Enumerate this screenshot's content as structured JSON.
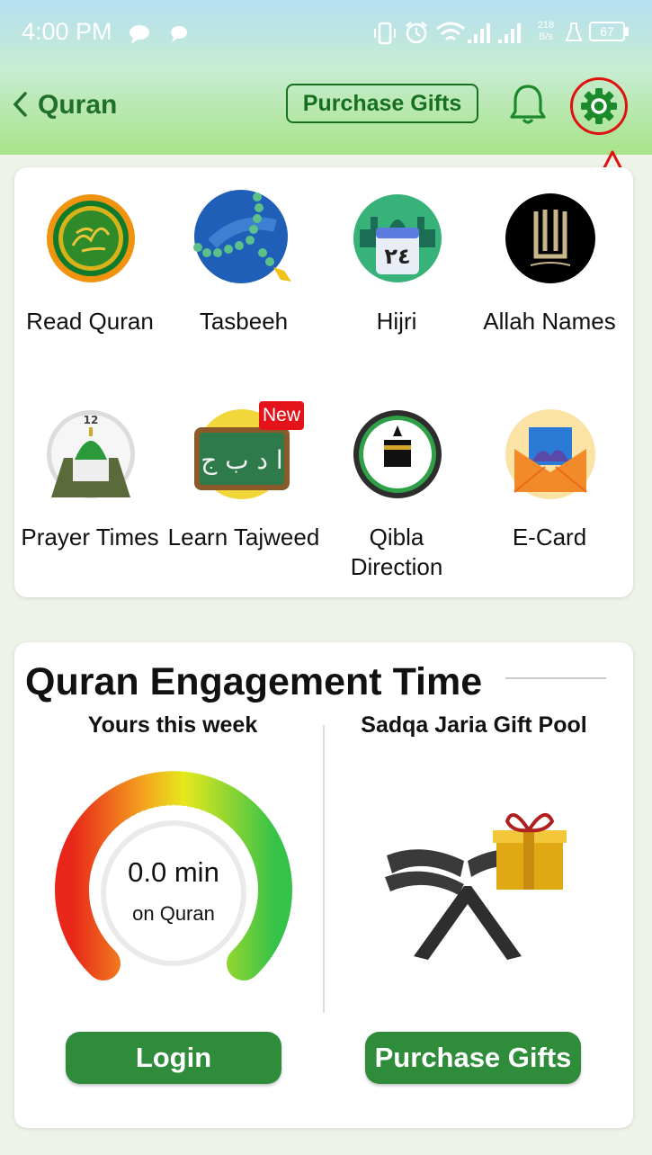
{
  "status_bar": {
    "time": "4:00 PM",
    "net_speed_value": "218",
    "net_speed_unit": "B/s",
    "battery": "67"
  },
  "header": {
    "title": "Quran",
    "purchase_label": "Purchase Gifts"
  },
  "features": [
    {
      "label": "Read Quran",
      "icon": "quran-emblem-icon"
    },
    {
      "label": "Tasbeeh",
      "icon": "prayer-beads-icon"
    },
    {
      "label": "Hijri",
      "icon": "hijri-calendar-icon",
      "calendar_text": "٢٤"
    },
    {
      "label": "Allah Names",
      "icon": "allah-calligraphy-icon"
    },
    {
      "label": "Prayer Times",
      "icon": "mosque-clock-icon",
      "clock_number": "12"
    },
    {
      "label": "Learn Tajweed",
      "icon": "arabic-chalkboard-icon",
      "badge": "New",
      "board_text": "ا د ب ج"
    },
    {
      "label": "Qibla Direction",
      "icon": "kaaba-compass-icon"
    },
    {
      "label": "E-Card",
      "icon": "envelope-card-icon"
    }
  ],
  "engagement": {
    "title": "Quran Engagement Time",
    "left_title": "Yours this week",
    "gauge_value": "0.0 min",
    "gauge_sub": "on Quran",
    "gauge_level": 0,
    "right_title": "Sadqa Jaria Gift Pool",
    "login_label": "Login",
    "purchase_label": "Purchase Gifts"
  },
  "colors": {
    "brand_green": "#2e8c3a",
    "title_green": "#20702c",
    "annotation_red": "#e01010",
    "badge_red": "#e4121b"
  }
}
